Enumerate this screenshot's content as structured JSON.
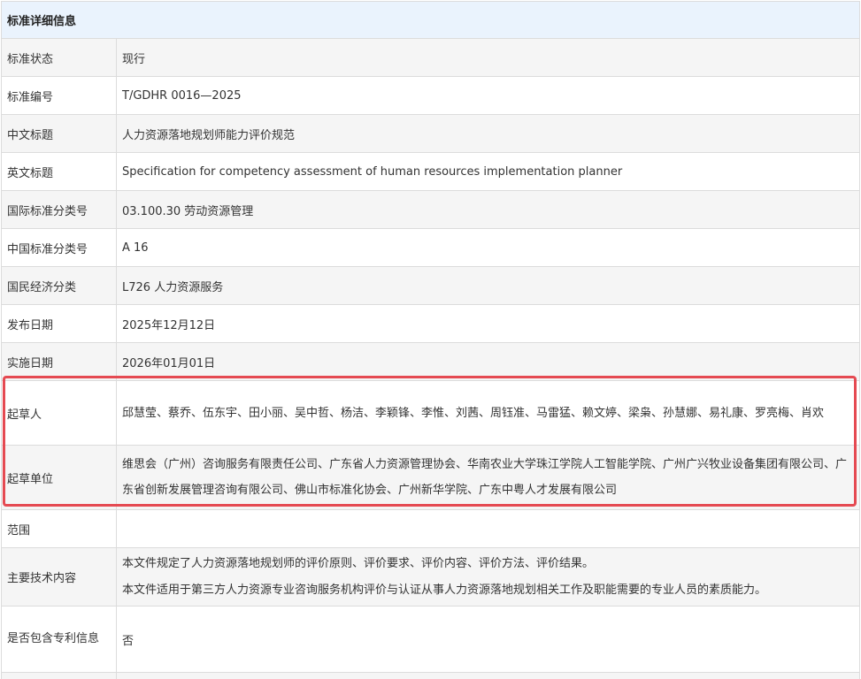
{
  "table": {
    "header": "标准详细信息",
    "rows": [
      {
        "label": "标准状态",
        "value": "现行"
      },
      {
        "label": "标准编号",
        "value": "T/GDHR 0016—2025"
      },
      {
        "label": "中文标题",
        "value": "人力资源落地规划师能力评价规范"
      },
      {
        "label": "英文标题",
        "value": "Specification for competency assessment of human resources implementation planner"
      },
      {
        "label": "国际标准分类号",
        "value": "03.100.30 劳动资源管理"
      },
      {
        "label": "中国标准分类号",
        "value": "A 16"
      },
      {
        "label": "国民经济分类",
        "value": "L726 人力资源服务"
      },
      {
        "label": "发布日期",
        "value": "2025年12月12日"
      },
      {
        "label": "实施日期",
        "value": "2026年01月01日"
      },
      {
        "label": "起草人",
        "value": "邱慧莹、蔡乔、伍东宇、田小丽、吴中哲、杨洁、李颖锋、李惟、刘茜、周钰准、马雷猛、赖文婷、梁枭、孙慧娜、易礼康、罗亮梅、肖欢"
      },
      {
        "label": "起草单位",
        "value": "维思会（广州）咨询服务有限责任公司、广东省人力资源管理协会、华南农业大学珠江学院人工智能学院、广州广兴牧业设备集团有限公司、广东省创新发展管理咨询有限公司、佛山市标准化协会、广州新华学院、广东中粤人才发展有限公司"
      },
      {
        "label": "范围",
        "value": ""
      },
      {
        "label": "主要技术内容",
        "value_lines": [
          "本文件规定了人力资源落地规划师的评价原则、评价要求、评价内容、评价方法、评价结果。",
          "本文件适用于第三方人力资源专业咨询服务机构评价与认证从事人力资源落地规划相关工作及职能需要的专业人员的素质能力。"
        ]
      },
      {
        "label": "是否包含专利信息",
        "value": "否"
      }
    ]
  },
  "colors": {
    "header_bg": "#eaf3fd",
    "alt_row_bg": "#f5f5f5",
    "border": "#dcdcdc",
    "highlight": "#e54a52"
  }
}
